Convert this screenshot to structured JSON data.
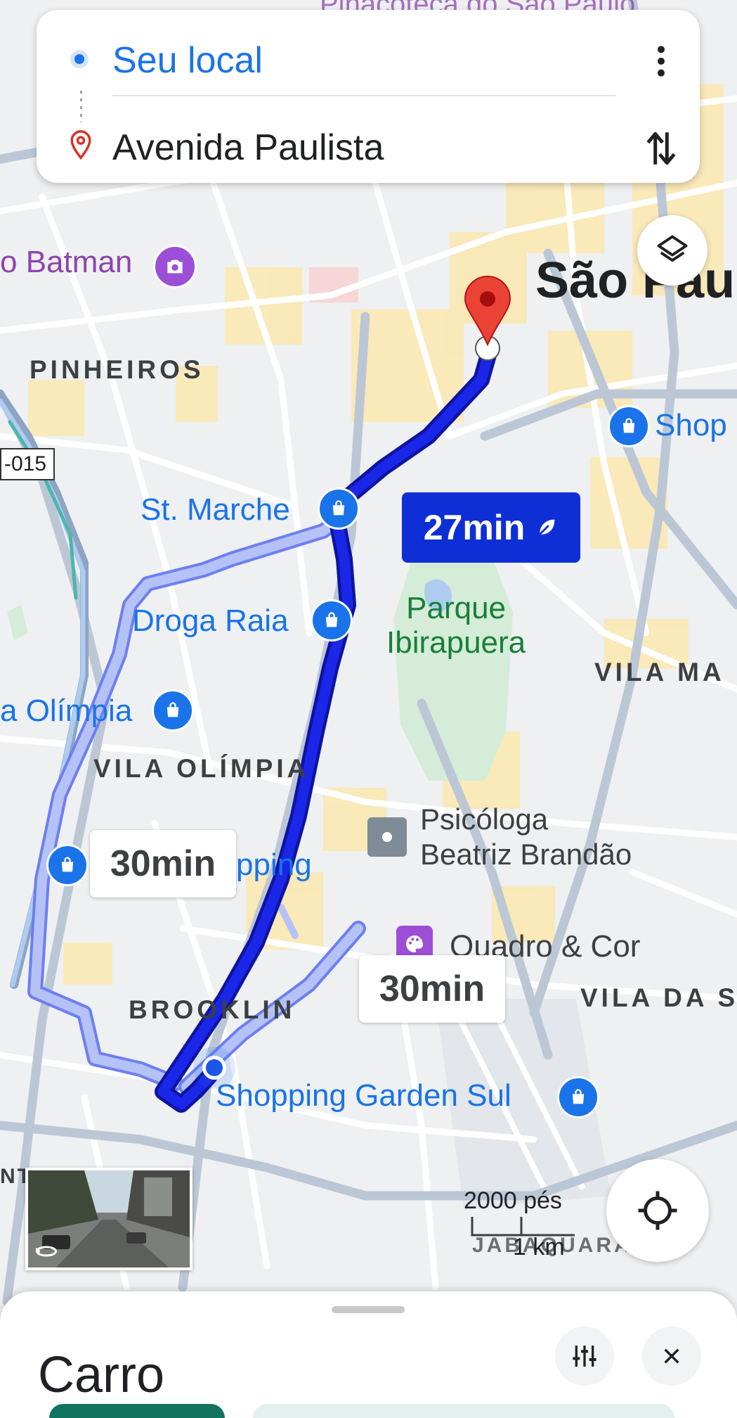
{
  "route": {
    "origin": "Seu local",
    "destination": "Avenida Paulista"
  },
  "map_labels": {
    "place_purple": "o Batman",
    "city": "São Pau",
    "pinheiros": "PINHEIROS",
    "shop_right": "Shop",
    "road_shield": "-015",
    "st_marche": "St. Marche",
    "droga_raia": "Droga Raia",
    "park_line1": "Parque",
    "park_line2": "Ibirapuera",
    "vila_ma": "VILA MA",
    "olimpia_shop": "a Olímpia",
    "vila_olimpia": "VILA OLÍMPIA",
    "psicologa_line1": "Psicóloga",
    "psicologa_line2": "Beatriz Brandão",
    "shopping_partial": "pping",
    "quadro": "Quadro & Cor",
    "vila_da": "VILA DA S",
    "brooklin": "BROOKLIN",
    "garden_sul": "Shopping Garden Sul",
    "top_partial": "Pinacoteca do São Paulo",
    "left_edge": "NT",
    "jabaquara": "JABAQUARA"
  },
  "times": {
    "primary": "27min",
    "alt_left": "30min",
    "alt_right": "30min"
  },
  "scale": {
    "imperial": "2000 pés",
    "metric": "1 km"
  },
  "bottom_sheet": {
    "mode": "Carro"
  },
  "colors": {
    "route_primary": "#1a27e8",
    "route_alt": "#a6b6f5",
    "accent": "#1a73e8",
    "pin": "#ea4335"
  },
  "icons": [
    "origin-dot-icon",
    "destination-pin-icon",
    "more-vert-icon",
    "swap-icon",
    "layers-icon",
    "shopping-bag-icon",
    "camera-icon",
    "eco-leaf-icon",
    "palette-icon",
    "crosshair-icon",
    "tune-icon",
    "close-icon",
    "street-view-icon"
  ]
}
